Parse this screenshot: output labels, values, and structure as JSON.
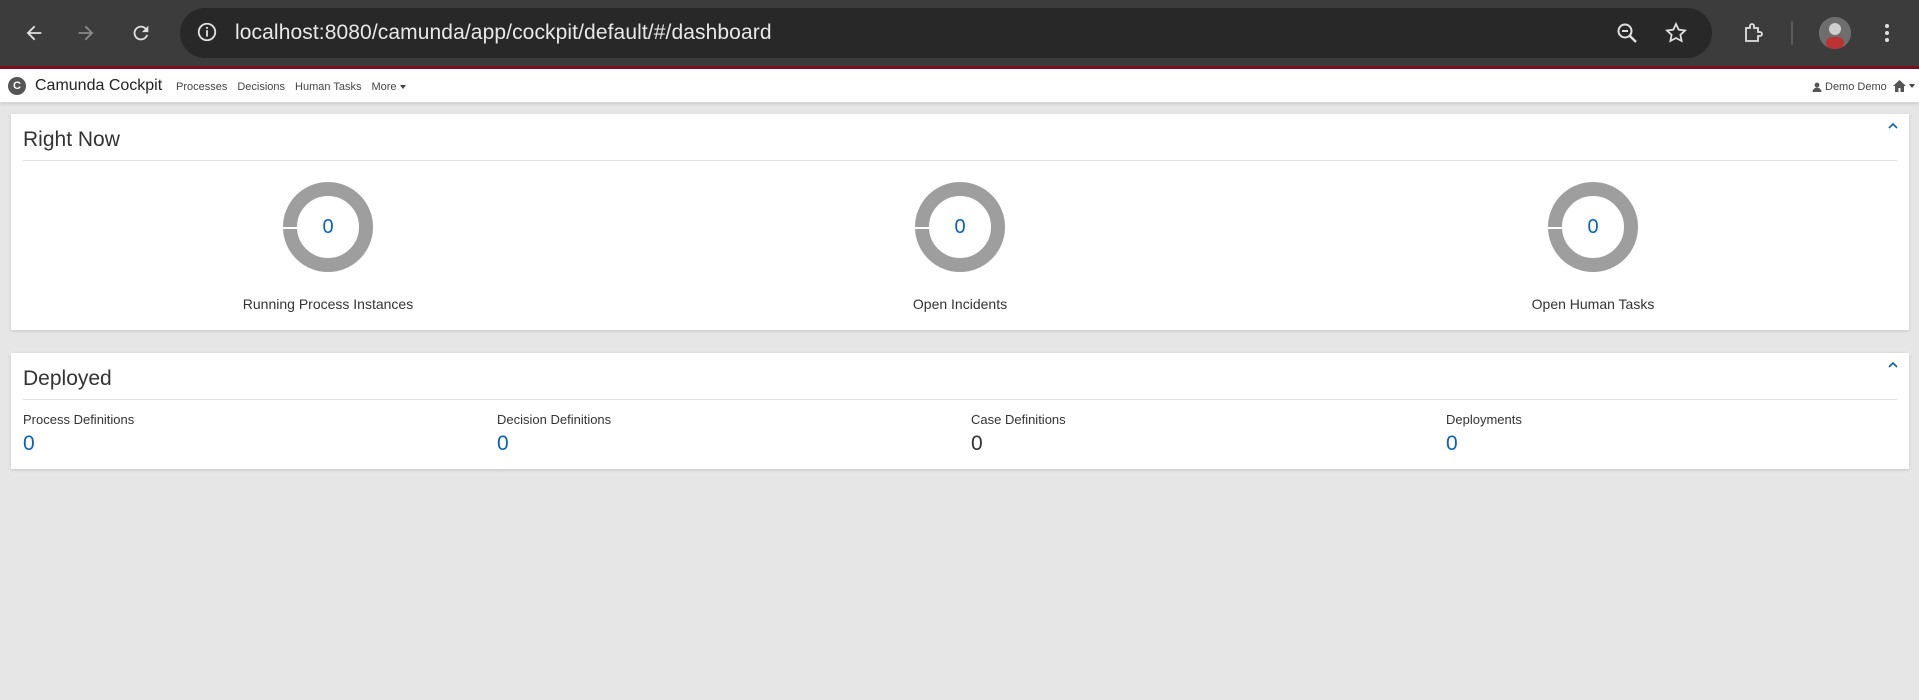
{
  "browser": {
    "url": "localhost:8080/camunda/app/cockpit/default/#/dashboard",
    "icons": [
      "back-icon",
      "forward-icon",
      "reload-icon",
      "site-info-icon",
      "zoom-icon",
      "bookmark-star-icon",
      "extensions-icon",
      "profile-avatar",
      "menu-dots-icon"
    ]
  },
  "app": {
    "brand": "Camunda Cockpit",
    "nav": {
      "processes": "Processes",
      "decisions": "Decisions",
      "human_tasks": "Human Tasks",
      "more": "More"
    },
    "user": "Demo Demo"
  },
  "right_now": {
    "title": "Right Now",
    "metrics": [
      {
        "label": "Running Process Instances",
        "value": "0"
      },
      {
        "label": "Open Incidents",
        "value": "0"
      },
      {
        "label": "Open Human Tasks",
        "value": "0"
      }
    ]
  },
  "deployed": {
    "title": "Deployed",
    "stats": [
      {
        "label": "Process Definitions",
        "value": "0",
        "link": true
      },
      {
        "label": "Decision Definitions",
        "value": "0",
        "link": true
      },
      {
        "label": "Case Definitions",
        "value": "0",
        "link": false
      },
      {
        "label": "Deployments",
        "value": "0",
        "link": true
      }
    ]
  },
  "colors": {
    "accent": "#0b62b7",
    "donut": "#9e9e9e",
    "background": "#e6e6e6"
  }
}
